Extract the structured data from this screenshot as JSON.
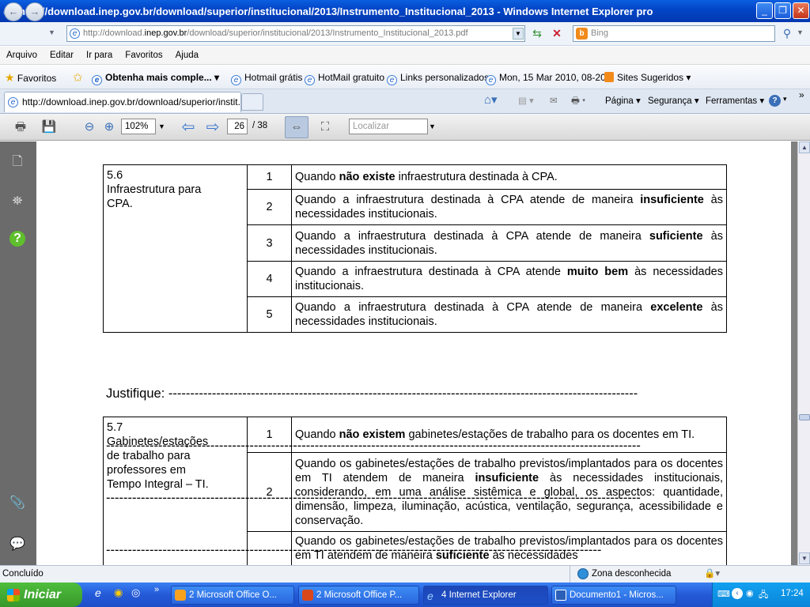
{
  "window": {
    "title": "http://download.inep.gov.br/download/superior/institucional/2013/Instrumento_Institucional_2013 - Windows Internet Explorer pro"
  },
  "address": {
    "url_prefix": "http://download.",
    "url_domain": "inep.gov.br",
    "url_rest": "/download/superior/institucional/2013/Instrumento_Institucional_2013.pdf",
    "search_placeholder": "Bing"
  },
  "menu": [
    "Arquivo",
    "Editar",
    "Ir para",
    "Favoritos",
    "Ajuda"
  ],
  "favorites_bar": {
    "favorites_label": "Favoritos",
    "items": [
      "Obtenha mais comple...",
      "Hotmail grátis",
      "HotMail gratuito",
      "Links personalizados",
      "Mon, 15 Mar 2010, 08-20",
      "Sites Sugeridos"
    ]
  },
  "tab": {
    "label": "http://download.inep.gov.br/download/superior/instit..."
  },
  "commands": [
    "Página",
    "Segurança",
    "Ferramentas"
  ],
  "pdf_toolbar": {
    "zoom": "102%",
    "page": "26",
    "total": "/ 38",
    "find_placeholder": "Localizar"
  },
  "document": {
    "table1": {
      "code": "5.6",
      "name": "Infraestrutura para CPA.",
      "rows": [
        {
          "n": "1",
          "pre": "Quando ",
          "bold": "não existe",
          "post": " infraestrutura destinada à CPA."
        },
        {
          "n": "2",
          "pre": "Quando a infraestrutura destinada à CPA atende de maneira ",
          "bold": "insuficiente",
          "post": " às necessidades institucionais."
        },
        {
          "n": "3",
          "pre": "Quando a infraestrutura destinada à CPA atende de maneira ",
          "bold": "suficiente",
          "post": " às necessidades institucionais."
        },
        {
          "n": "4",
          "pre": "Quando a infraestrutura destinada à CPA atende ",
          "bold": "muito bem",
          "post": " às necessidades institucionais."
        },
        {
          "n": "5",
          "pre": "Quando a infraestrutura destinada à CPA atende de maneira ",
          "bold": "excelente",
          "post": " às necessidades institucionais."
        }
      ]
    },
    "justify_lines": [
      "Justifique: ------------------------------------------------------------------------------------------------------------",
      "---------------------------------------------------------------------------------------------------------------------------",
      "---------------------------------------------------------------------------------------------------------------------------",
      "------------------------------------------------------------------------------------------------------------------"
    ],
    "table2": {
      "code": "5.7",
      "name": "Gabinetes/estações de trabalho para professores em Tempo Integral – TI.",
      "rows": [
        {
          "n": "1",
          "pre": "Quando ",
          "bold": "não existem",
          "post": " gabinetes/estações de trabalho para os docentes em TI."
        },
        {
          "n": "2",
          "pre": "Quando os gabinetes/estações de trabalho previstos/implantados para os docentes em TI atendem de maneira ",
          "bold": "insuficiente",
          "post": " às necessidades institucionais, considerando, em uma análise sistêmica e global, os aspectos: quantidade, dimensão, limpeza, iluminação, acústica, ventilação, segurança, acessibilidade e conservação."
        },
        {
          "n": "",
          "pre": "Quando os gabinetes/estações de trabalho previstos/implantados para os docentes em TI atendem de maneira ",
          "bold": "suficiente",
          "post": " às necessidades"
        }
      ]
    }
  },
  "status": {
    "text": "Concluído",
    "zone": "Zona desconhecida"
  },
  "taskbar": {
    "start": "Iniciar",
    "tasks": [
      "2 Microsoft Office O...",
      "2 Microsoft Office P...",
      "4 Internet Explorer",
      "Documento1 - Micros..."
    ],
    "clock": "17:24"
  }
}
